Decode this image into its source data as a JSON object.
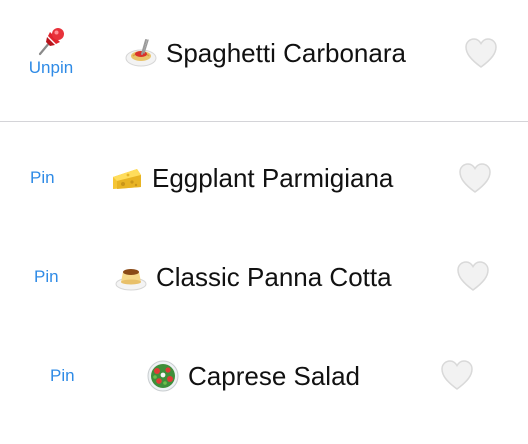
{
  "pinned": {
    "unpin_label": "Unpin",
    "recipe": {
      "title": "Spaghetti Carbonara",
      "icon": "spaghetti-icon",
      "favorite": false
    }
  },
  "recipes": [
    {
      "pin_label": "Pin",
      "title": "Eggplant Parmigiana",
      "icon": "cheese-icon",
      "favorite": false
    },
    {
      "pin_label": "Pin",
      "title": "Classic Panna Cotta",
      "icon": "custard-icon",
      "favorite": false
    },
    {
      "pin_label": "Pin",
      "title": "Caprese Salad",
      "icon": "salad-icon",
      "favorite": false
    }
  ],
  "colors": {
    "accent": "#2f8be6",
    "text": "#111111",
    "divider": "#d4d4d8",
    "heart_outline": "#d9d9d9"
  }
}
